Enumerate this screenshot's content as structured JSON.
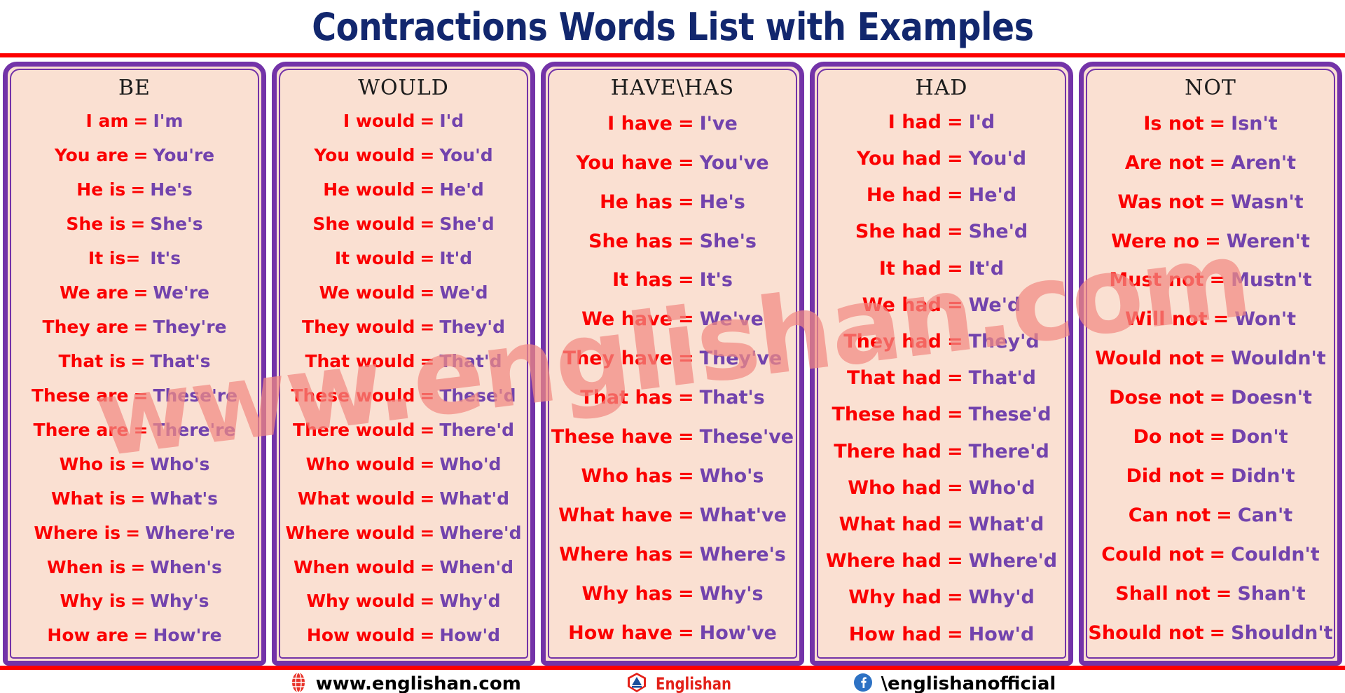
{
  "title": "Contractions Words List with Examples",
  "watermark": "www.englishan.com",
  "colors": {
    "title": "#12276e",
    "rule": "#fd0000",
    "card_border": "#7333a8",
    "card_bg": "#fae0d2",
    "full_form": "#fb0000",
    "contraction": "#7243ad",
    "watermark": "#f28b84"
  },
  "columns": [
    {
      "header": "BE",
      "rows": [
        {
          "full": "I am",
          "eq": "=",
          "short": "I'm"
        },
        {
          "full": "You are",
          "eq": "=",
          "short": "You're"
        },
        {
          "full": "He is",
          "eq": "=",
          "short": "He's"
        },
        {
          "full": "She is",
          "eq": "=",
          "short": "She's"
        },
        {
          "full": "It is=",
          "eq": "",
          "short": "It's"
        },
        {
          "full": "We are",
          "eq": "=",
          "short": "We're"
        },
        {
          "full": "They are",
          "eq": "=",
          "short": "They're"
        },
        {
          "full": "That is",
          "eq": "=",
          "short": "That's"
        },
        {
          "full": "These are",
          "eq": "=",
          "short": "These're"
        },
        {
          "full": "There are",
          "eq": "=",
          "short": "There're"
        },
        {
          "full": "Who is",
          "eq": "=",
          "short": "Who's"
        },
        {
          "full": "What is",
          "eq": "=",
          "short": "What's"
        },
        {
          "full": "Where is",
          "eq": "=",
          "short": "Where're"
        },
        {
          "full": "When is",
          "eq": "=",
          "short": "When's"
        },
        {
          "full": "Why is",
          "eq": "=",
          "short": "Why's"
        },
        {
          "full": "How are",
          "eq": "=",
          "short": "How're"
        }
      ]
    },
    {
      "header": "WOULD",
      "rows": [
        {
          "full": "I would",
          "eq": "=",
          "short": "I'd"
        },
        {
          "full": "You would",
          "eq": "=",
          "short": "You'd"
        },
        {
          "full": "He would",
          "eq": "=",
          "short": "He'd"
        },
        {
          "full": "She would",
          "eq": "=",
          "short": "She'd"
        },
        {
          "full": "It would",
          "eq": "=",
          "short": "It'd"
        },
        {
          "full": "We would",
          "eq": "=",
          "short": "We'd"
        },
        {
          "full": "They would",
          "eq": "=",
          "short": "They'd"
        },
        {
          "full": "That would",
          "eq": "=",
          "short": "That'd"
        },
        {
          "full": "These would",
          "eq": "=",
          "short": "These'd"
        },
        {
          "full": "There would",
          "eq": "=",
          "short": "There'd"
        },
        {
          "full": "Who would",
          "eq": "=",
          "short": "Who'd"
        },
        {
          "full": "What would",
          "eq": "=",
          "short": "What'd"
        },
        {
          "full": "Where would",
          "eq": "=",
          "short": "Where'd"
        },
        {
          "full": "When would",
          "eq": "=",
          "short": "When'd"
        },
        {
          "full": "Why would",
          "eq": "=",
          "short": "Why'd"
        },
        {
          "full": "How would",
          "eq": "=",
          "short": "How'd"
        }
      ]
    },
    {
      "header": "HAVE\\HAS",
      "rows": [
        {
          "full": "I have",
          "eq": "=",
          "short": "I've"
        },
        {
          "full": "You have",
          "eq": "=",
          "short": "You've"
        },
        {
          "full": "He has",
          "eq": "=",
          "short": "He's"
        },
        {
          "full": "She has",
          "eq": "=",
          "short": "She's"
        },
        {
          "full": "It has",
          "eq": "=",
          "short": "It's"
        },
        {
          "full": "We have",
          "eq": "=",
          "short": "We've"
        },
        {
          "full": "They have",
          "eq": "=",
          "short": "They've"
        },
        {
          "full": "That has",
          "eq": "=",
          "short": "That's"
        },
        {
          "full": "These have",
          "eq": "=",
          "short": "These've"
        },
        {
          "full": "Who has",
          "eq": "=",
          "short": "Who's"
        },
        {
          "full": "What have",
          "eq": "=",
          "short": "What've"
        },
        {
          "full": "Where has",
          "eq": "=",
          "short": "Where's"
        },
        {
          "full": "Why has",
          "eq": "=",
          "short": "Why's"
        },
        {
          "full": "How have",
          "eq": "=",
          "short": "How've"
        }
      ]
    },
    {
      "header": "HAD",
      "rows": [
        {
          "full": "I had",
          "eq": "=",
          "short": "I'd"
        },
        {
          "full": "You had",
          "eq": "=",
          "short": "You'd"
        },
        {
          "full": "He had",
          "eq": "=",
          "short": "He'd"
        },
        {
          "full": "She had",
          "eq": "=",
          "short": "She'd"
        },
        {
          "full": "It had",
          "eq": "=",
          "short": "It'd"
        },
        {
          "full": "We had",
          "eq": "=",
          "short": "We'd"
        },
        {
          "full": "They had",
          "eq": "=",
          "short": "They'd"
        },
        {
          "full": "That had",
          "eq": "=",
          "short": "That'd"
        },
        {
          "full": "These had",
          "eq": "=",
          "short": "These'd"
        },
        {
          "full": "There had",
          "eq": "=",
          "short": "There'd"
        },
        {
          "full": "Who had",
          "eq": "=",
          "short": "Who'd"
        },
        {
          "full": "What had",
          "eq": "=",
          "short": "What'd"
        },
        {
          "full": "Where had",
          "eq": "=",
          "short": "Where'd"
        },
        {
          "full": "Why had",
          "eq": "=",
          "short": "Why'd"
        },
        {
          "full": "How had",
          "eq": "=",
          "short": "How'd"
        }
      ]
    },
    {
      "header": "NOT",
      "rows": [
        {
          "full": "Is not",
          "eq": "=",
          "short": "Isn't"
        },
        {
          "full": "Are not",
          "eq": "=",
          "short": "Aren't"
        },
        {
          "full": "Was not",
          "eq": "=",
          "short": "Wasn't"
        },
        {
          "full": "Were no",
          "eq": "=",
          "short": "Weren't"
        },
        {
          "full": "Must not",
          "eq": "=",
          "short": "Mustn't"
        },
        {
          "full": "Will not",
          "eq": "=",
          "short": "Won't"
        },
        {
          "full": "Would not",
          "eq": "=",
          "short": "Wouldn't"
        },
        {
          "full": "Dose not",
          "eq": "=",
          "short": "Doesn't"
        },
        {
          "full": "Do not",
          "eq": "=",
          "short": "Don't"
        },
        {
          "full": "Did not",
          "eq": "=",
          "short": "Didn't"
        },
        {
          "full": "Can not",
          "eq": "=",
          "short": "Can't"
        },
        {
          "full": "Could not",
          "eq": "=",
          "short": "Couldn't"
        },
        {
          "full": "Shall not",
          "eq": "=",
          "short": "Shan't"
        },
        {
          "full": "Should not",
          "eq": "=",
          "short": "Shouldn't"
        }
      ]
    }
  ],
  "footer": {
    "website": "www.englishan.com",
    "brand": "Englishan",
    "facebook_handle": "\\englishanofficial"
  }
}
